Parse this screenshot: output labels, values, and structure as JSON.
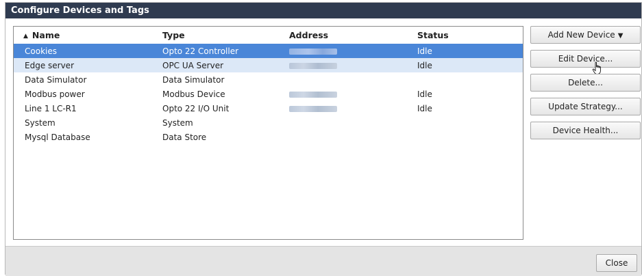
{
  "dialog": {
    "title": "Configure Devices and Tags"
  },
  "table": {
    "columns": {
      "name": "Name",
      "type": "Type",
      "address": "Address",
      "status": "Status"
    },
    "rows": [
      {
        "name": "Cookies",
        "type": "Opto 22 Controller",
        "address_redacted": true,
        "status": "Idle",
        "state": "selected"
      },
      {
        "name": "Edge server",
        "type": "OPC UA Server",
        "address_redacted": true,
        "status": "Idle",
        "state": "hovered"
      },
      {
        "name": "Data Simulator",
        "type": "Data Simulator",
        "address_redacted": false,
        "status": "",
        "state": ""
      },
      {
        "name": "Modbus power",
        "type": "Modbus Device",
        "address_redacted": true,
        "status": "Idle",
        "state": ""
      },
      {
        "name": "Line 1 LC-R1",
        "type": "Opto 22 I/O Unit",
        "address_redacted": true,
        "status": "Idle",
        "state": ""
      },
      {
        "name": "System",
        "type": "System",
        "address_redacted": false,
        "status": "",
        "state": ""
      },
      {
        "name": "Mysql Database",
        "type": "Data Store",
        "address_redacted": false,
        "status": "",
        "state": ""
      }
    ],
    "sort_icon": "sort-ascending-icon"
  },
  "actions": {
    "add_new_device": "Add New Device",
    "edit_device": "Edit Device...",
    "delete": "Delete...",
    "update_strategy": "Update Strategy...",
    "device_health": "Device Health..."
  },
  "footer": {
    "close": "Close"
  },
  "colors": {
    "titlebar": "#2f3b50",
    "selected_row": "#4a86d8",
    "hover_row": "#dce8f7"
  }
}
